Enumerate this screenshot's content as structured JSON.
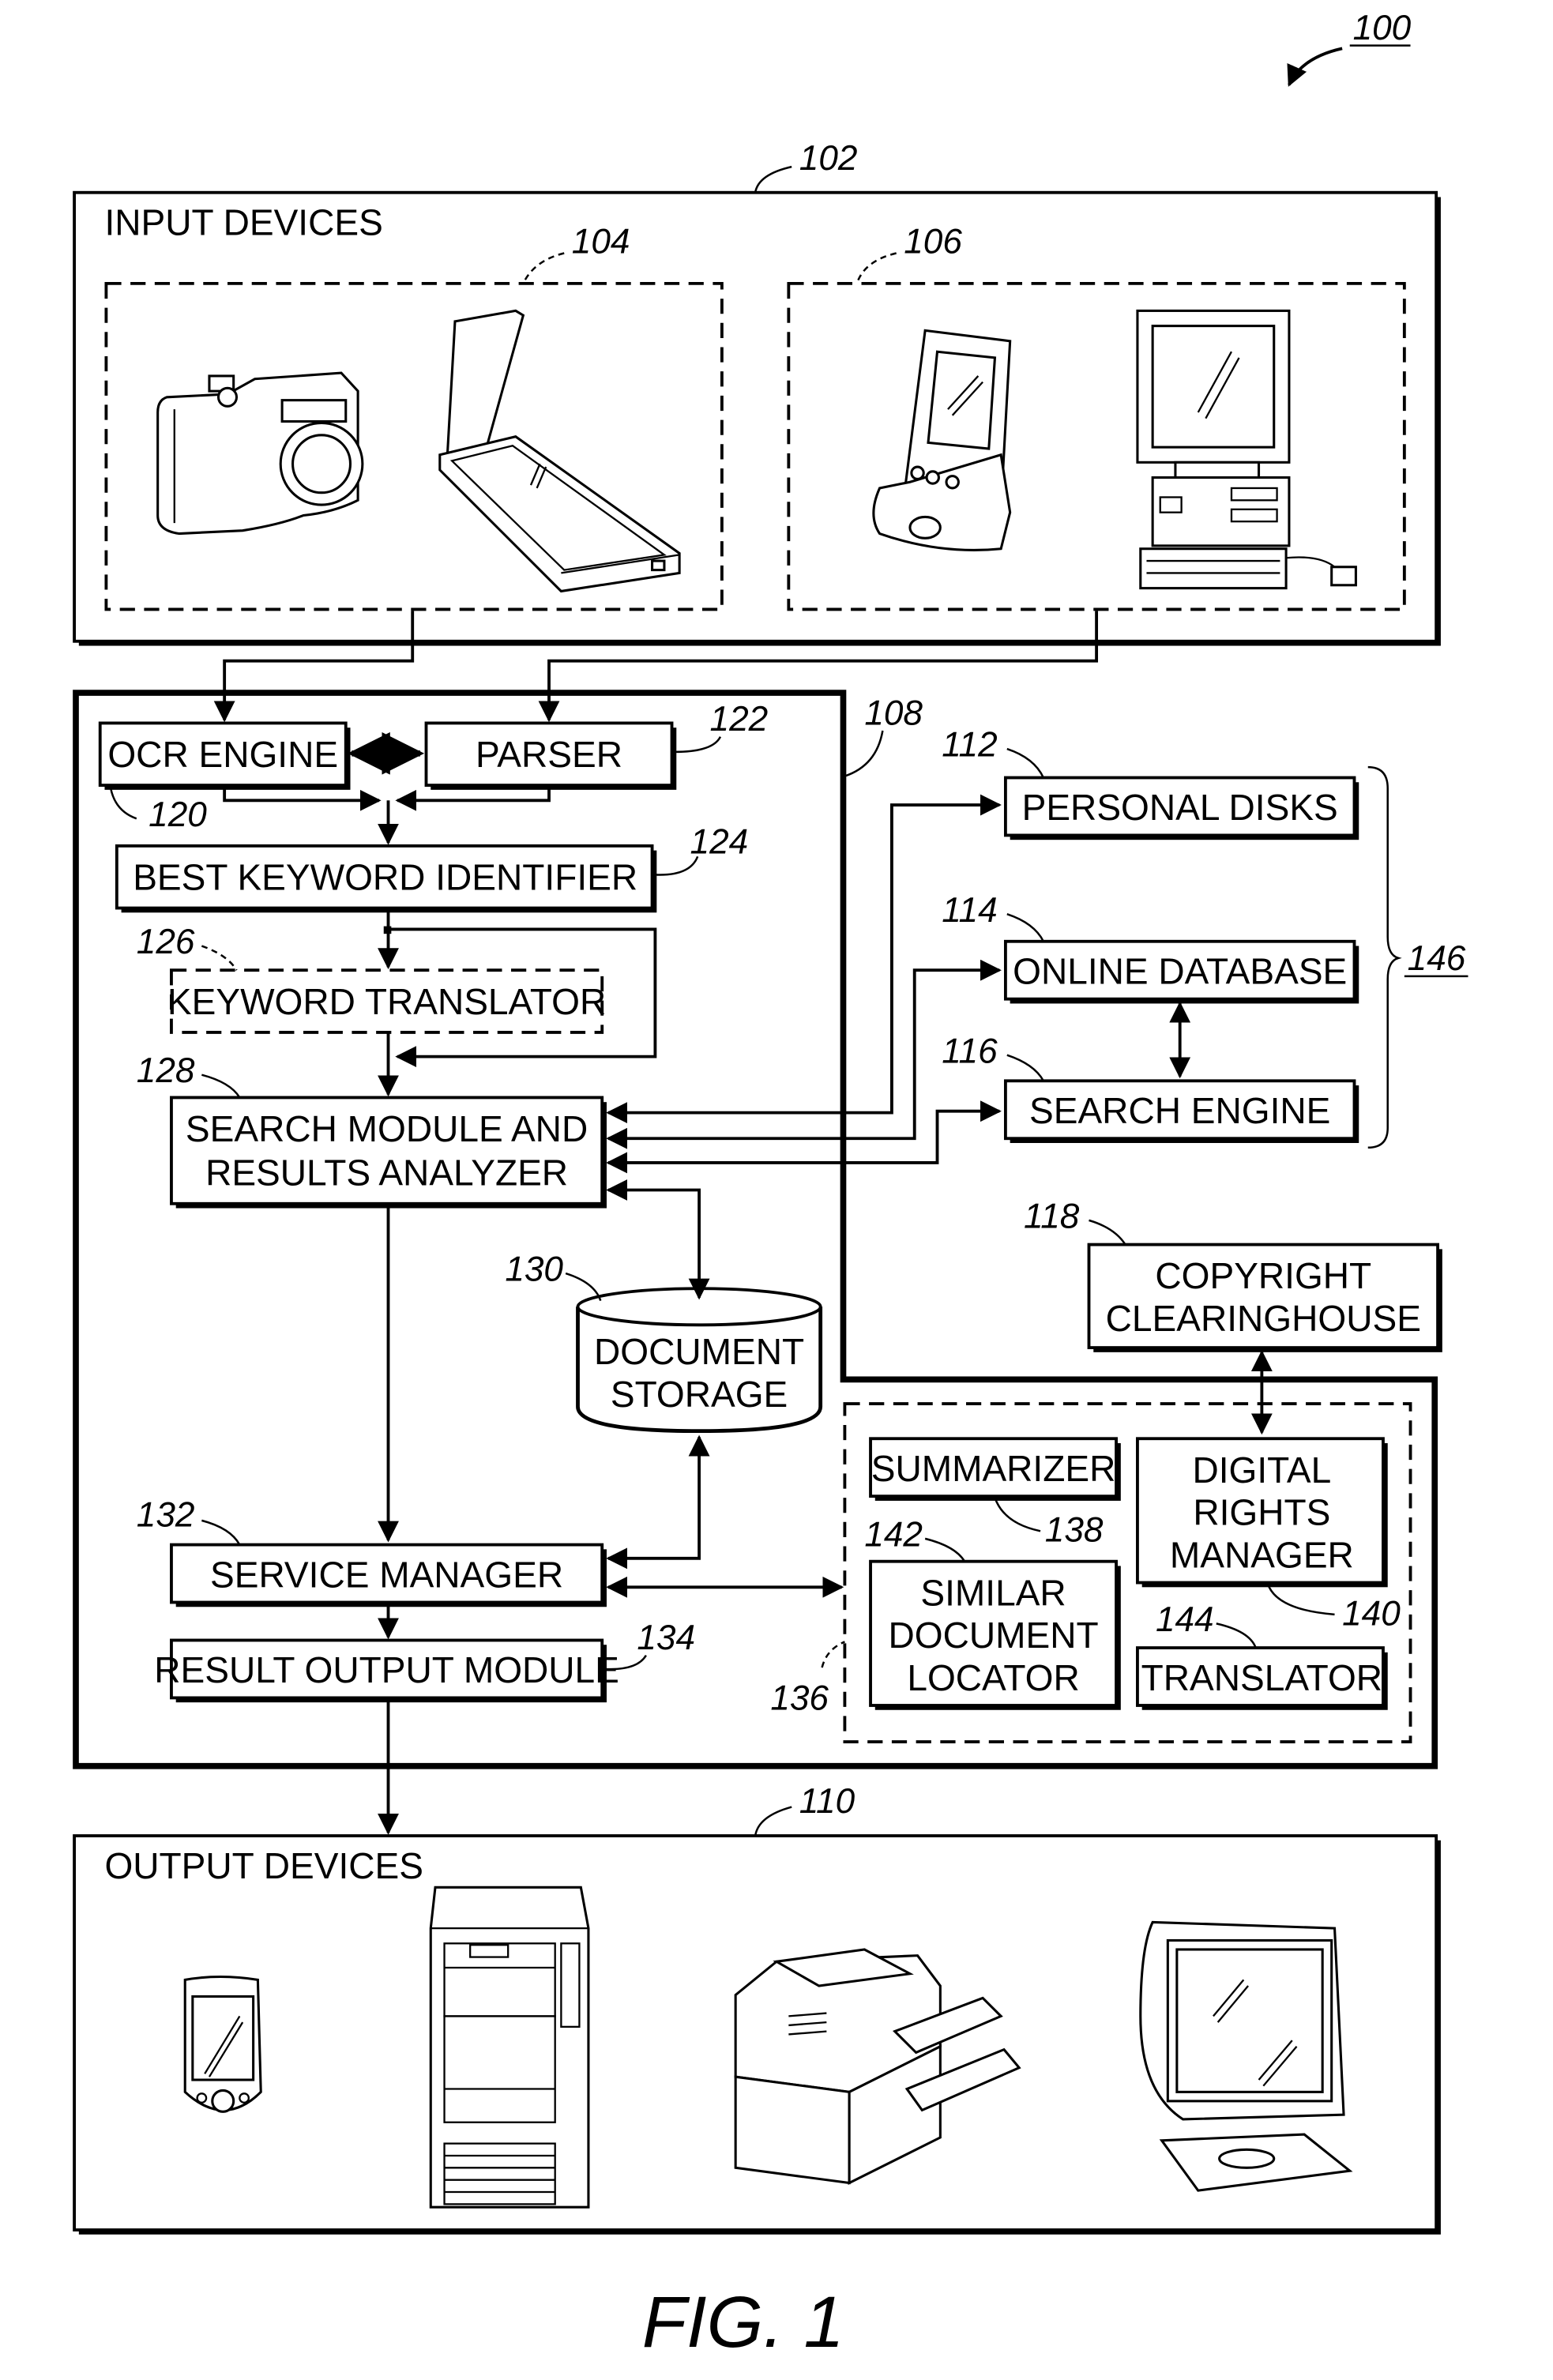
{
  "figure": {
    "title": "FIG. 1",
    "system_ref": "100"
  },
  "input_devices": {
    "ref": "102",
    "label": "INPUT DEVICES",
    "group_a": {
      "ref": "104",
      "devices": [
        "camera-icon",
        "scanner-icon"
      ]
    },
    "group_b": {
      "ref": "106",
      "devices": [
        "pda-icon",
        "desktop-computer-icon"
      ]
    }
  },
  "system": {
    "ref": "108",
    "modules": {
      "ocr_engine": {
        "ref": "120",
        "label": "OCR ENGINE"
      },
      "parser": {
        "ref": "122",
        "label": "PARSER"
      },
      "best_keyword_identifier": {
        "ref": "124",
        "label": "BEST KEYWORD IDENTIFIER"
      },
      "keyword_translator": {
        "ref": "126",
        "label": "KEYWORD TRANSLATOR"
      },
      "search_module": {
        "ref": "128",
        "label_line1": "SEARCH MODULE AND",
        "label_line2": "RESULTS ANALYZER"
      },
      "document_storage": {
        "ref": "130",
        "label_line1": "DOCUMENT",
        "label_line2": "STORAGE"
      },
      "service_manager": {
        "ref": "132",
        "label": "SERVICE MANAGER"
      },
      "result_output_module": {
        "ref": "134",
        "label": "RESULT OUTPUT MODULE"
      }
    },
    "services": {
      "ref": "136",
      "summarizer": {
        "ref": "138",
        "label": "SUMMARIZER"
      },
      "digital_rights_manager": {
        "ref": "140",
        "label_line1": "DIGITAL",
        "label_line2": "RIGHTS",
        "label_line3": "MANAGER"
      },
      "similar_document_locator": {
        "ref": "142",
        "label_line1": "SIMILAR",
        "label_line2": "DOCUMENT",
        "label_line3": "LOCATOR"
      },
      "translator": {
        "ref": "144",
        "label": "TRANSLATOR"
      }
    }
  },
  "external_sources": {
    "ref": "146",
    "personal_disks": {
      "ref": "112",
      "label": "PERSONAL DISKS"
    },
    "online_database": {
      "ref": "114",
      "label": "ONLINE DATABASE"
    },
    "search_engine": {
      "ref": "116",
      "label": "SEARCH ENGINE"
    }
  },
  "copyright_clearinghouse": {
    "ref": "118",
    "label_line1": "COPYRIGHT",
    "label_line2": "CLEARINGHOUSE"
  },
  "output_devices": {
    "ref": "110",
    "label": "OUTPUT DEVICES",
    "devices": [
      "pda-icon",
      "tower-computer-icon",
      "printer-copier-icon",
      "monitor-icon"
    ]
  }
}
